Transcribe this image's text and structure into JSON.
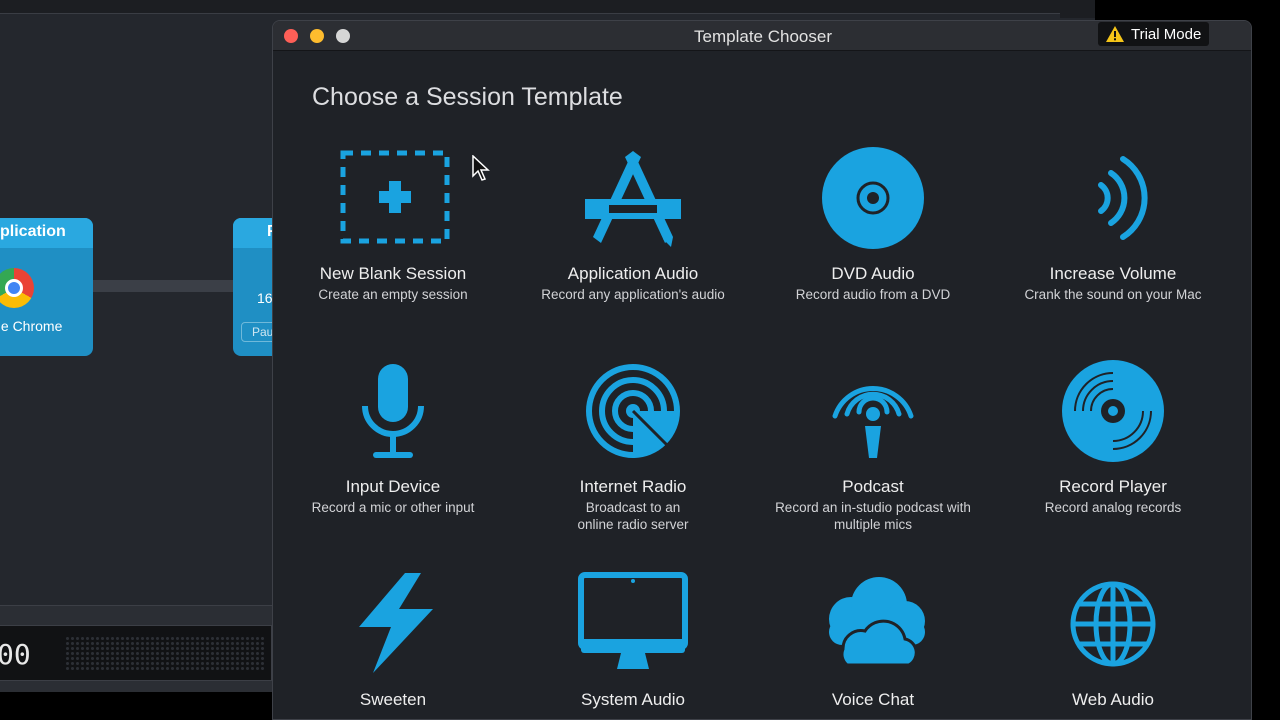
{
  "background": {
    "node_app_header": "plication",
    "node_app_name": "gle Chrome",
    "node2_header": "F",
    "node2_value": "16",
    "node2_pill": "Pau",
    "timer": "00"
  },
  "window": {
    "title": "Template Chooser",
    "trial_badge": "Trial Mode"
  },
  "heading": "Choose a Session Template",
  "accent_color": "#1aa3e0",
  "templates": [
    {
      "icon": "new-session-icon",
      "title": "New Blank Session",
      "desc": "Create an empty session"
    },
    {
      "icon": "application-audio-icon",
      "title": "Application Audio",
      "desc": "Record any application's audio"
    },
    {
      "icon": "dvd-icon",
      "title": "DVD Audio",
      "desc": "Record audio from a DVD"
    },
    {
      "icon": "increase-volume-icon",
      "title": "Increase Volume",
      "desc": "Crank the sound on your Mac"
    },
    {
      "icon": "microphone-icon",
      "title": "Input Device",
      "desc": "Record a mic or other input"
    },
    {
      "icon": "internet-radio-icon",
      "title": "Internet Radio",
      "desc": "Broadcast to an online radio server"
    },
    {
      "icon": "podcast-icon",
      "title": "Podcast",
      "desc": "Record an in-studio podcast with multiple mics"
    },
    {
      "icon": "record-player-icon",
      "title": "Record Player",
      "desc": "Record analog records"
    },
    {
      "icon": "lightning-icon",
      "title": "Sweeten",
      "desc": ""
    },
    {
      "icon": "monitor-icon",
      "title": "System Audio",
      "desc": ""
    },
    {
      "icon": "cloud-icon",
      "title": "Voice Chat",
      "desc": ""
    },
    {
      "icon": "globe-icon",
      "title": "Web Audio",
      "desc": ""
    }
  ]
}
